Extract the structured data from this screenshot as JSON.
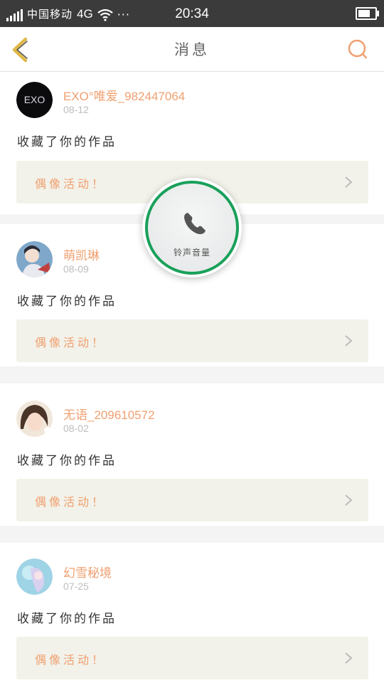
{
  "status_bar": {
    "carrier": "中国移动",
    "network": "4G",
    "time": "20:34",
    "more": "···"
  },
  "nav": {
    "title": "消息",
    "back_icon": "chevron-left-icon",
    "search_icon": "search-icon",
    "accent_color": "#e0b84a"
  },
  "messages": [
    {
      "name": "EXO°唯爱_982447064",
      "date": "08-12",
      "action": "收藏了你的作品",
      "link": "偶像活动！",
      "avatar": "exo-logo-avatar"
    },
    {
      "name": "萌凯琳",
      "date": "08-09",
      "action": "收藏了你的作品",
      "link": "偶像活动！",
      "avatar": "user-avatar"
    },
    {
      "name": "无语_209610572",
      "date": "08-02",
      "action": "收藏了你的作品",
      "link": "偶像活动！",
      "avatar": "user-avatar"
    },
    {
      "name": "幻雪秘境",
      "date": "07-25",
      "action": "收藏了你的作品",
      "link": "偶像活动！",
      "avatar": "user-avatar"
    }
  ],
  "overlay": {
    "label": "铃声音量",
    "icon": "phone-icon",
    "ring_color": "#19a05a"
  }
}
